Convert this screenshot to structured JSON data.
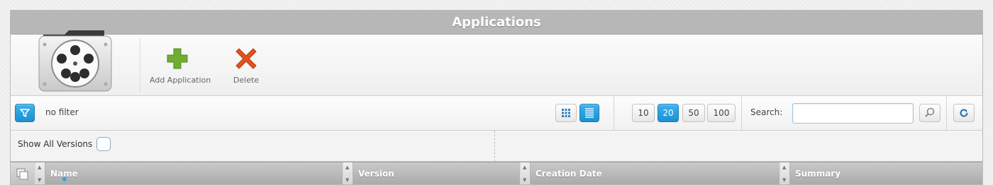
{
  "window": {
    "title": "Applications"
  },
  "toolbar": {
    "add_label": "Add Application",
    "delete_label": "Delete"
  },
  "filter": {
    "status_text": "no filter"
  },
  "pagination": {
    "sizes": [
      "10",
      "20",
      "50",
      "100"
    ],
    "active": "20"
  },
  "search": {
    "label": "Search:",
    "value": "",
    "placeholder": ""
  },
  "options": {
    "show_all_versions_label": "Show All Versions",
    "show_all_versions_checked": false
  },
  "table": {
    "columns": [
      "Name",
      "Version",
      "Creation Date",
      "Summary"
    ]
  },
  "colors": {
    "accent_blue": "#1c8fd0",
    "title_bar": "#b7b7b7",
    "add_green": "#6fae2f",
    "delete_orange": "#e0531d"
  }
}
